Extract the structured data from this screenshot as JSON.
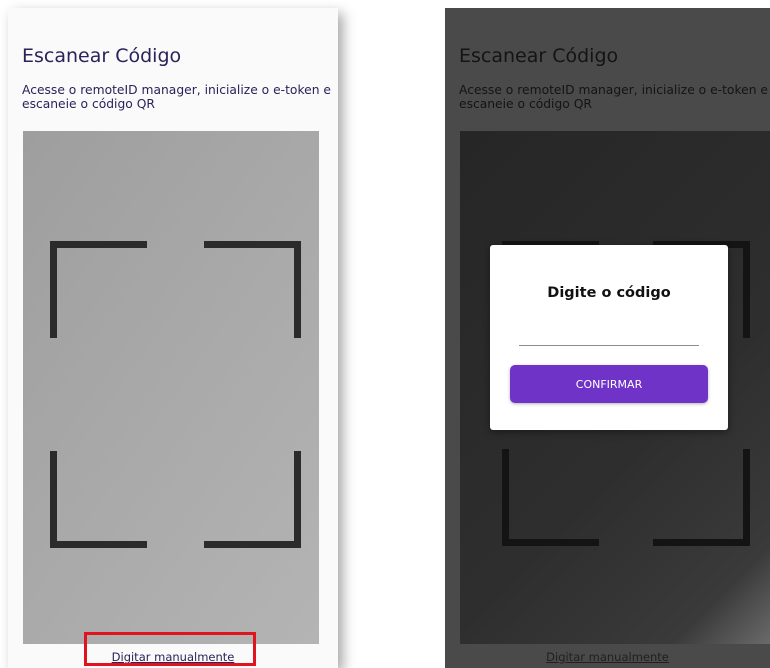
{
  "screens": [
    {
      "title": "Escanear Código",
      "subtitle": "Acesse o remoteID manager, inicialize o e-token e escaneie o código QR",
      "manual_link": "Digitar manualmente"
    },
    {
      "title": "Escanear Código",
      "subtitle": "Acesse o remoteID manager, inicialize o e-token e escaneie o código QR",
      "manual_link": "Digitar manualmente",
      "dialog": {
        "title": "Digite o código",
        "input_value": "",
        "confirm_label": "CONFIRMAR"
      }
    }
  ],
  "colors": {
    "primary_button": "#6f34c7",
    "heading_text": "#2a235a",
    "highlight": "#e0141e"
  }
}
